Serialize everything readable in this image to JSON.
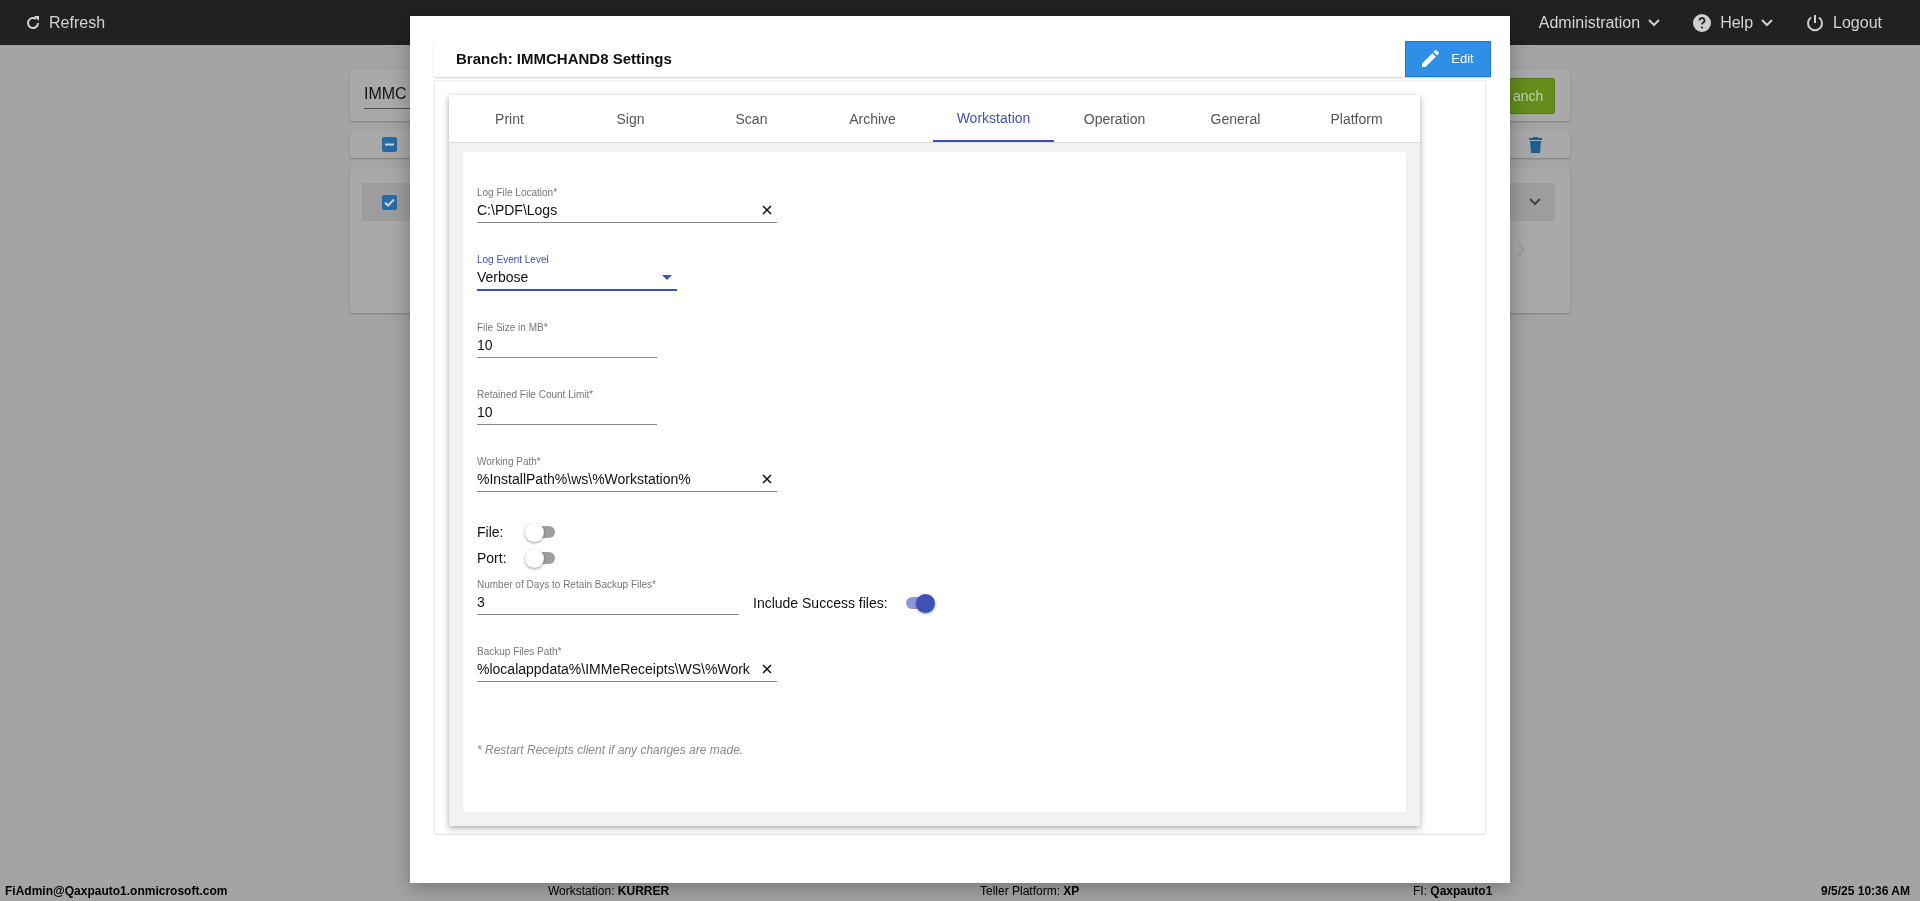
{
  "topbar": {
    "refresh": "Refresh",
    "menus": [
      {
        "label": "Administration",
        "kind": "dropdown"
      },
      {
        "label": "Help",
        "kind": "help"
      },
      {
        "label": "Logout",
        "kind": "logout"
      }
    ]
  },
  "background": {
    "search_value": "IMMC",
    "add_button": "anch",
    "select_all": {
      "indeterminate": true
    },
    "row": {
      "checked": true
    }
  },
  "modal": {
    "title": "Branch: IMMCHAND8 Settings",
    "edit_button": "Edit",
    "tabs": [
      {
        "label": "Print",
        "selected": false
      },
      {
        "label": "Sign",
        "selected": false
      },
      {
        "label": "Scan",
        "selected": false
      },
      {
        "label": "Archive",
        "selected": false
      },
      {
        "label": "Workstation",
        "selected": true
      },
      {
        "label": "Operation",
        "selected": false
      },
      {
        "label": "General",
        "selected": false
      },
      {
        "label": "Platform",
        "selected": false
      }
    ],
    "fields": [
      {
        "kind": "text",
        "label": "Log File Location*",
        "value": "C:\\PDF\\Logs",
        "clearable": true
      },
      {
        "kind": "select",
        "label": "Log Event Level",
        "value": "Verbose",
        "focused": true
      },
      {
        "kind": "text",
        "label": "File Size in MB*",
        "value": "10",
        "clearable": false
      },
      {
        "kind": "text",
        "label": "Retained File Count Limit*",
        "value": "10",
        "clearable": false
      },
      {
        "kind": "text",
        "label": "Working Path*",
        "value": "%InstallPath%\\ws\\%Workstation%",
        "clearable": true
      },
      {
        "kind": "toggle",
        "label": "File:",
        "on": false
      },
      {
        "kind": "toggle",
        "label": "Port:",
        "on": false
      },
      {
        "kind": "text",
        "label": "Number of Days to Retain Backup Files*",
        "value": "3",
        "clearable": false,
        "side_toggle": {
          "label": "Include Success files:",
          "on": true
        }
      },
      {
        "kind": "text",
        "label": "Backup Files Path*",
        "value": "%localappdata%\\IMMeReceipts\\WS\\%Work",
        "clearable": true
      }
    ],
    "note": "* Restart Receipts client if any changes are made."
  },
  "status_bar": {
    "user": "FiAdmin@Qaxpauto1.onmicrosoft.com",
    "workstation": "Workstation: **KURRER**",
    "platform": "Teller Platform: **XP**",
    "fi": "FI: **Qaxpauto1**",
    "datetime": "9/5/25 10:36 AM"
  }
}
